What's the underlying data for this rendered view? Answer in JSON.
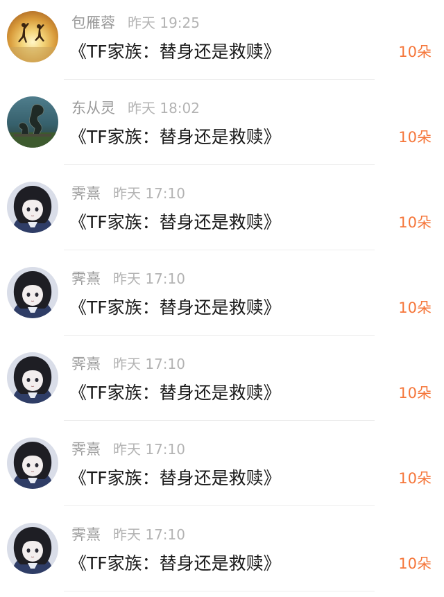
{
  "colors": {
    "accent": "#f5763a",
    "name_text": "#9a9a9a",
    "time_text": "#b3b3b3",
    "title_text": "#1a1a1a",
    "divider": "#ececec"
  },
  "items": [
    {
      "avatar": "sunset-jump-avatar",
      "name": "包雁蓉",
      "time": "昨天 19:25",
      "title": "《TF家族：替身还是救赎》",
      "count": "10朵"
    },
    {
      "avatar": "dragon-statue-avatar",
      "name": "东从灵",
      "time": "昨天 18:02",
      "title": "《TF家族：替身还是救赎》",
      "count": "10朵"
    },
    {
      "avatar": "anime-girl-avatar",
      "name": "霁熹",
      "time": "昨天 17:10",
      "title": "《TF家族：替身还是救赎》",
      "count": "10朵"
    },
    {
      "avatar": "anime-girl-avatar",
      "name": "霁熹",
      "time": "昨天 17:10",
      "title": "《TF家族：替身还是救赎》",
      "count": "10朵"
    },
    {
      "avatar": "anime-girl-avatar",
      "name": "霁熹",
      "time": "昨天 17:10",
      "title": "《TF家族：替身还是救赎》",
      "count": "10朵"
    },
    {
      "avatar": "anime-girl-avatar",
      "name": "霁熹",
      "time": "昨天 17:10",
      "title": "《TF家族：替身还是救赎》",
      "count": "10朵"
    },
    {
      "avatar": "anime-girl-avatar",
      "name": "霁熹",
      "time": "昨天 17:10",
      "title": "《TF家族：替身还是救赎》",
      "count": "10朵"
    }
  ]
}
